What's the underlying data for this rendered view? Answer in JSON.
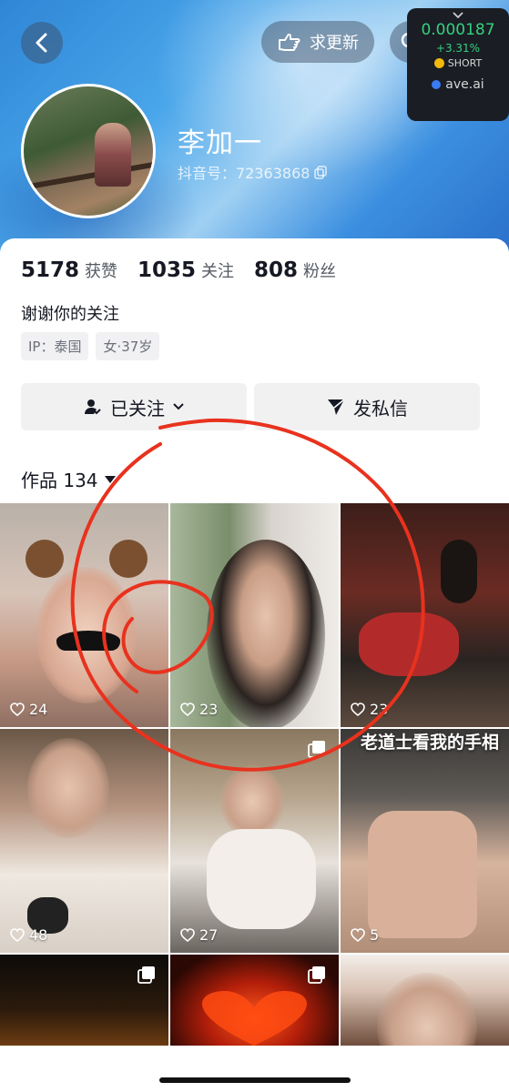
{
  "header": {
    "update_label": "求更新"
  },
  "ticker": {
    "price": "0.000187",
    "change": "+3.31%",
    "position": "SHORT",
    "site": "ave.ai"
  },
  "profile": {
    "name": "李加一",
    "id_label": "抖音号：72363868",
    "bio": "谢谢你的关注",
    "tags": [
      "IP：泰国",
      "女·37岁"
    ]
  },
  "stats": [
    {
      "num": "5178",
      "label": "获赞"
    },
    {
      "num": "1035",
      "label": "关注"
    },
    {
      "num": "808",
      "label": "粉丝"
    }
  ],
  "actions": {
    "follow_label": "已关注",
    "message_label": "发私信"
  },
  "works": {
    "tab_label": "作品 134"
  },
  "thumbs": [
    {
      "likes": "24"
    },
    {
      "likes": "23"
    },
    {
      "likes": "23"
    },
    {
      "likes": "48"
    },
    {
      "likes": "27"
    },
    {
      "likes": "5",
      "caption": "老道士看我的手相"
    },
    {},
    {},
    {}
  ],
  "colors": {
    "ticker_up": "#35d07f",
    "annotation_red": "#e8321e"
  }
}
